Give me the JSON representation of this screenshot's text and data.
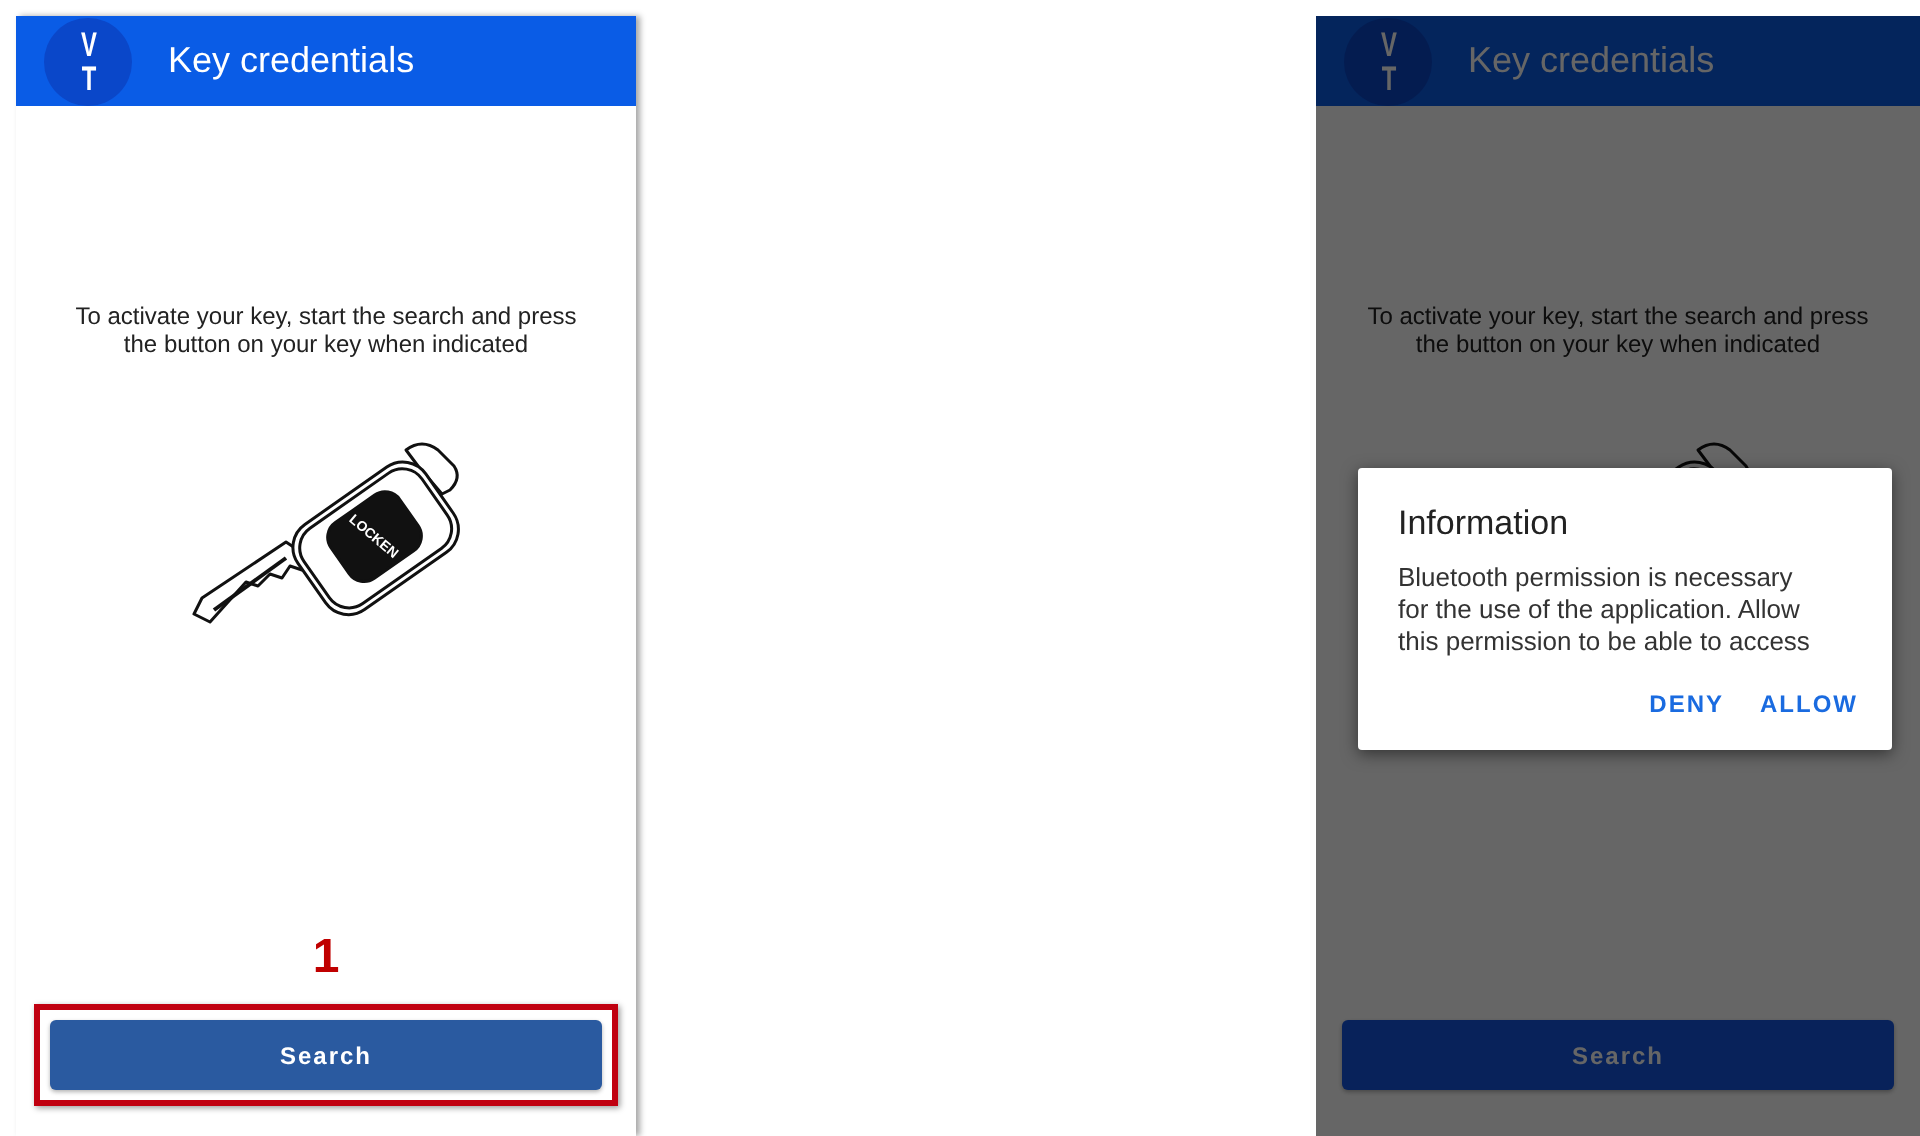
{
  "screens": [
    {
      "header": {
        "logo_text": "VT",
        "title": "Key credentials"
      },
      "instruction": "To activate your key, start the search and press the button on your key when indicated",
      "key_label": "LOCKEN",
      "callout": {
        "number": "1"
      },
      "search_button": {
        "label": "Search",
        "highlighted": true
      },
      "dimmed": false
    },
    {
      "header": {
        "logo_text": "VT",
        "title": "Key credentials"
      },
      "instruction": "To activate your key, start the search and press the button on your key when indicated",
      "search_button": {
        "label": "Search",
        "highlighted": false
      },
      "dimmed": true,
      "dialog": {
        "title": "Information",
        "message": "Bluetooth permission is necessary for the use of the application. Allow this permission to be able to access",
        "actions": [
          "DENY",
          "ALLOW"
        ]
      }
    }
  ]
}
